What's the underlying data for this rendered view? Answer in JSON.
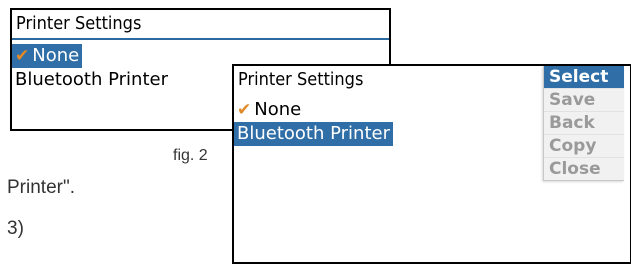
{
  "left_screen": {
    "title": "Printer Settings",
    "items": [
      {
        "label": "None"
      },
      {
        "label": "Bluetooth Printer"
      }
    ]
  },
  "caption": "fig. 2",
  "body_text": {
    "line1": "Printer\".",
    "line2": "3)"
  },
  "right_screen": {
    "title": "Printer Settings",
    "items": [
      {
        "label": "None"
      },
      {
        "label": "Bluetooth Printer"
      }
    ],
    "menu": [
      "Select",
      "Save",
      "Back",
      "Copy",
      "Close"
    ]
  },
  "colors": {
    "selection": "#2f6ea6",
    "check": "#e08a2a"
  }
}
